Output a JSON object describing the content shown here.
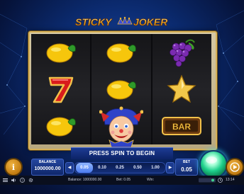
{
  "game": {
    "logo_word1": "STICKY",
    "logo_word2": "JOKER"
  },
  "reels": [
    [
      "lemon",
      "seven",
      "lemon"
    ],
    [
      "lemon",
      "lemon",
      "joker"
    ],
    [
      "grapes",
      "star",
      "bar"
    ]
  ],
  "symbols": {
    "bar_text": "BAR",
    "seven_text": "7"
  },
  "message": "PRESS SPIN TO BEGIN",
  "balance": {
    "label": "BALANCE",
    "value": "1000000.00"
  },
  "bet": {
    "label": "BET",
    "value": "0.05"
  },
  "bet_options": [
    {
      "label": "0.05",
      "selected": true
    },
    {
      "label": "0.10",
      "selected": false
    },
    {
      "label": "0.25",
      "selected": false
    },
    {
      "label": "0.50",
      "selected": false
    },
    {
      "label": "1.00",
      "selected": false
    }
  ],
  "buttons": {
    "info": "i",
    "left_arrow": "◀",
    "right_arrow": "▶"
  },
  "status_bar": {
    "balance": "Balance: 1000000.00",
    "bet": "Bet: 0.05",
    "win": "Win:",
    "time": "13:14"
  },
  "colors": {
    "frame_gold": "#d6b15a",
    "spin_green": "#1fd08c",
    "panel_blue": "#1c3b93",
    "orange_button": "#c07a10"
  }
}
